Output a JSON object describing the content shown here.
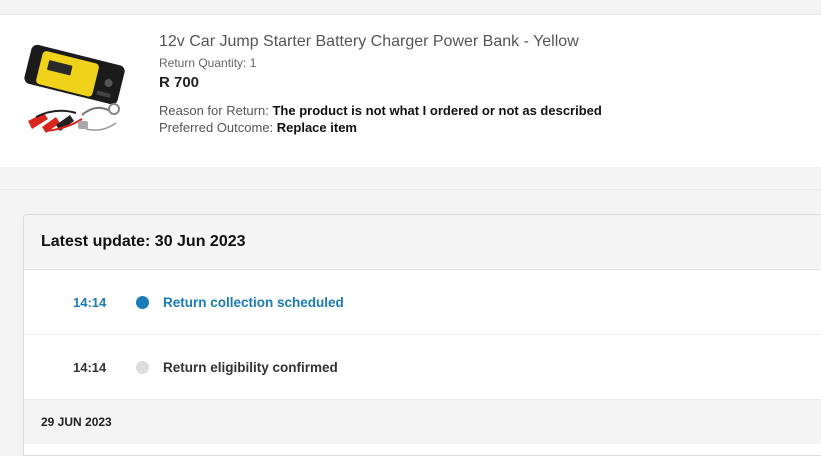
{
  "product": {
    "image_name": "jump-starter-kit-image",
    "title": "12v Car Jump Starter Battery Charger Power Bank - Yellow",
    "quantity_label": "Return Quantity: 1",
    "price": "R 700",
    "reason_label": "Reason for Return:",
    "reason_value": "The product is not what I ordered or not as described",
    "outcome_label": "Preferred Outcome:",
    "outcome_value": "Replace item"
  },
  "tracker": {
    "latest_update": "Latest update: 30 Jun 2023",
    "events": [
      {
        "time": "14:14",
        "label": "Return collection scheduled",
        "status": "active"
      },
      {
        "time": "14:14",
        "label": "Return eligibility confirmed",
        "status": "done"
      }
    ],
    "next_date": "29 JUN 2023"
  },
  "colors": {
    "accent": "#1a7bb9",
    "product_yellow": "#f1d21a",
    "inactive_dot": "#dcdcdc",
    "band_gray": "#f4f4f4"
  }
}
